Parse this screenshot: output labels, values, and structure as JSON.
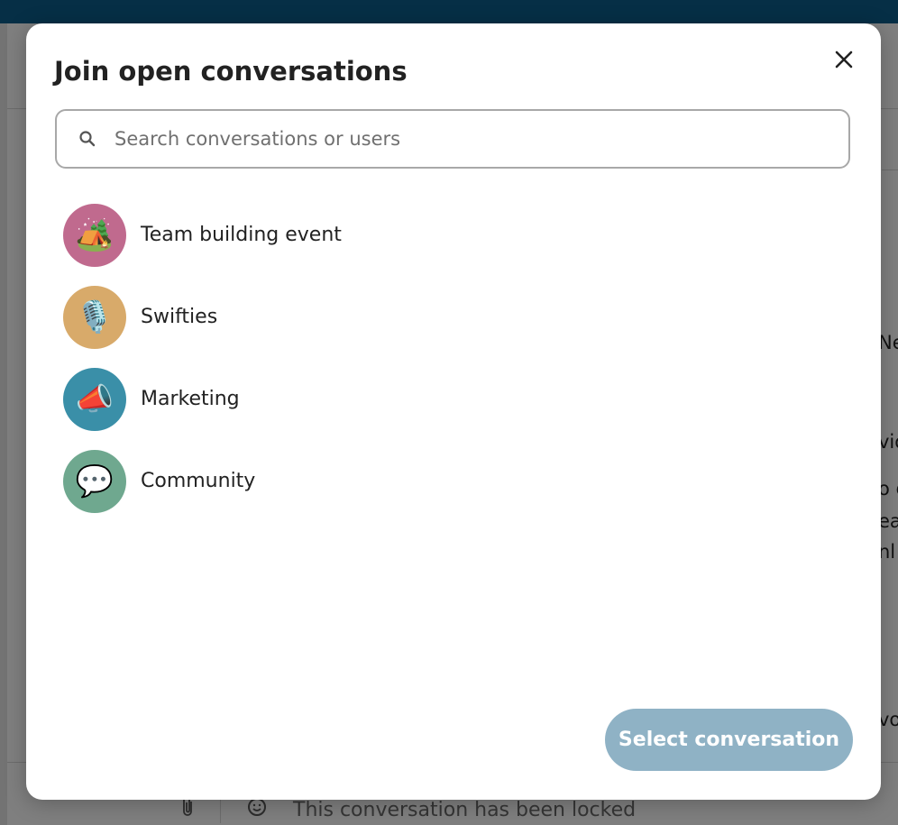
{
  "background": {
    "composer_placeholder": "This conversation has been locked",
    "partial_text": [
      "Ne",
      "vio",
      "o g",
      "ea",
      "nl",
      "vo"
    ]
  },
  "modal": {
    "title": "Join open conversations",
    "close_icon": "close-icon",
    "search": {
      "placeholder": "Search conversations or users",
      "value": ""
    },
    "conversations": [
      {
        "label": "Team building event",
        "emoji": "🏕️",
        "avatar_color": "#c06a8e"
      },
      {
        "label": "Swifties",
        "emoji": "🎙️",
        "avatar_color": "#d8aa6a"
      },
      {
        "label": "Marketing",
        "emoji": "📣",
        "avatar_color": "#3a8fa8"
      },
      {
        "label": "Community",
        "emoji": "💬",
        "avatar_color": "#6fa88f"
      }
    ],
    "select_button_label": "Select conversation"
  },
  "colors": {
    "top_bar": "#0d5b86",
    "button_disabled": "#8fb2c5"
  }
}
